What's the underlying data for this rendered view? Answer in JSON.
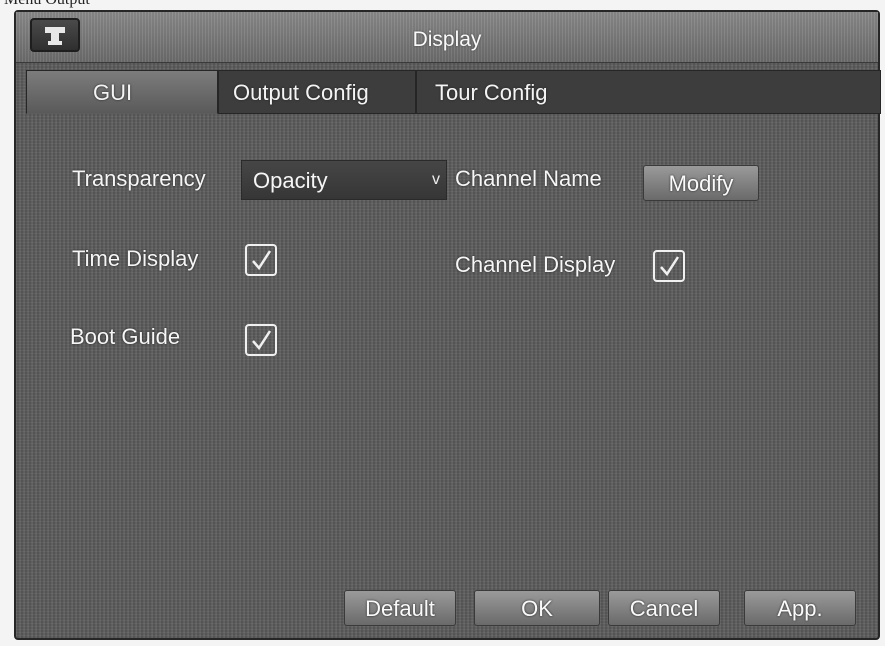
{
  "page_header": "Menu Output",
  "window": {
    "title": "Display",
    "icon": "monitor-icon"
  },
  "tabs": [
    {
      "label": "GUI",
      "active": true
    },
    {
      "label": "Output Config",
      "active": false
    },
    {
      "label": "Tour Config",
      "active": false
    }
  ],
  "gui": {
    "transparency_label": "Transparency",
    "transparency_value": "Opacity",
    "transparency_arrow": "v",
    "channel_name_label": "Channel Name",
    "modify_button": "Modify",
    "time_display_label": "Time Display",
    "time_display_checked": true,
    "channel_display_label": "Channel Display",
    "channel_display_checked": true,
    "boot_guide_label": "Boot Guide",
    "boot_guide_checked": true
  },
  "footer": {
    "default_button": "Default",
    "ok_button": "OK",
    "cancel_button": "Cancel",
    "apply_button": "App."
  }
}
